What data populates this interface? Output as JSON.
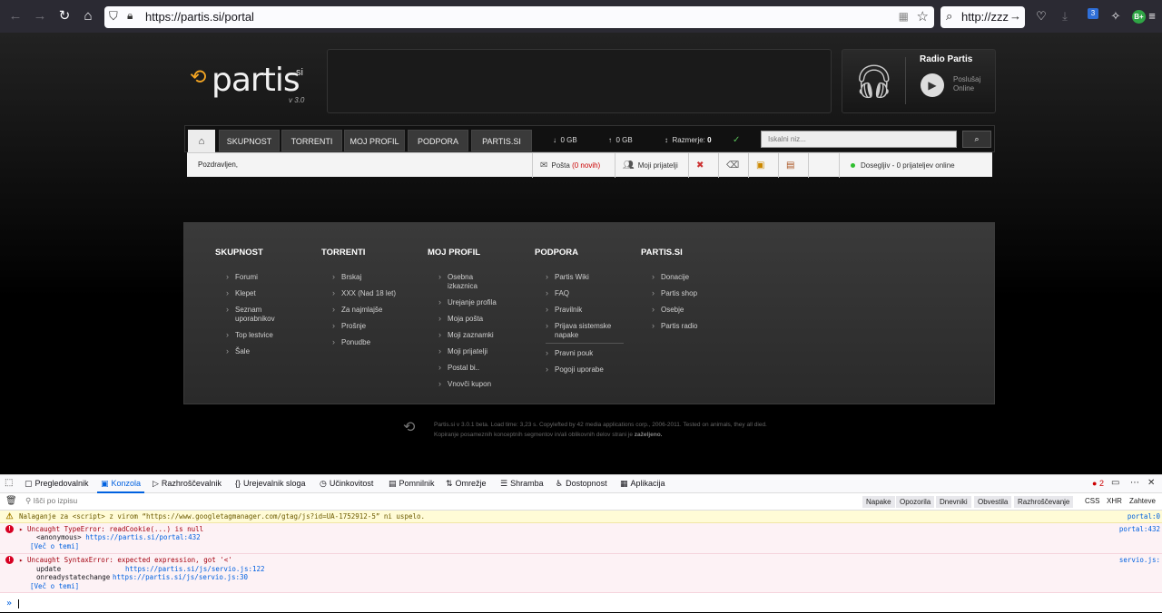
{
  "browser": {
    "url": "https://partis.si/portal",
    "search_text": "http://zzz",
    "ext_badge": "3",
    "profile_badge": "B+"
  },
  "header": {
    "logo_text": "partis",
    "logo_si": ".si",
    "logo_version": "v 3.0",
    "radio_title": "Radio Partis",
    "radio_line1": "Poslušaj",
    "radio_line2": "Online"
  },
  "nav": {
    "tabs": [
      "SKUPNOST",
      "TORRENTI",
      "MOJ PROFIL",
      "PODPORA",
      "PARTIS.SI"
    ],
    "download": "0 GB",
    "upload": "0 GB",
    "ratio_label": "Razmerje:",
    "ratio_value": "0",
    "search_placeholder": "Iskalni niz..."
  },
  "subbar": {
    "greeting": "Pozdravljen,",
    "mail_label": "Pošta",
    "mail_count": "(0 novih)",
    "friends_label": "Moji prijatelji",
    "status": "Dosegljiv - 0 prijateljev online"
  },
  "sitemap": [
    {
      "title": "SKUPNOST",
      "items": [
        "Forumi",
        "Klepet",
        "Seznam uporabnikov",
        "Top lestvice",
        "Šale"
      ]
    },
    {
      "title": "TORRENTI",
      "items": [
        "Brskaj",
        "XXX (Nad 18 let)",
        "Za najmlajše",
        "Prošnje",
        "Ponudbe"
      ]
    },
    {
      "title": "MOJ PROFIL",
      "items": [
        "Osebna izkaznica",
        "Urejanje profila",
        "Moja pošta",
        "Moji zaznamki",
        "Moji prijatelji",
        "Postal bi..",
        "Vnovči kupon"
      ]
    },
    {
      "title": "PODPORA",
      "items": [
        "Partis Wiki",
        "FAQ",
        "Pravilnik",
        "Prijava sistemske napake",
        "Pravni pouk",
        "Pogoji uporabe"
      ]
    },
    {
      "title": "PARTIS.SI",
      "items": [
        "Donacije",
        "Partis shop",
        "Osebje",
        "Partis radio"
      ]
    }
  ],
  "footer": {
    "line1": "Partis.si v 3.0.1 beta. Load time: 3,23 s. Copylefted by 42 media applications corp., 2006-2011. Tested on animals, they all died.",
    "line2": "Kopiranje posameznih konceptnih segmentov in/ali oblikovnih delov strani je",
    "line2_bold": "zaželjeno."
  },
  "devtools": {
    "tabs": [
      "Pregledovalnik",
      "Konzola",
      "Razhroščevalnik",
      "Urejevalnik sloga",
      "Učinkovitost",
      "Pomnilnik",
      "Omrežje",
      "Shramba",
      "Dostopnost",
      "Aplikacija"
    ],
    "error_count": "2",
    "filter_placeholder": "Išči po izpisu",
    "chips": [
      "Napake",
      "Opozorila",
      "Dnevniki",
      "Obvestila",
      "Razhroščevanje"
    ],
    "plain_filters": [
      "CSS",
      "XHR",
      "Zahteve"
    ],
    "warn_msg": "Nalaganje za <script> z virom “https://www.googletagmanager.com/gtag/js?id=UA-1752912-5” ni uspelo.",
    "warn_src": "portal:0",
    "err1_msg": "Uncaught TypeError: readCookie(...) is null",
    "err1_sub_fn": "<anonymous>",
    "err1_sub_link": "https://partis.si/portal:432",
    "err1_more": "[Več o temi]",
    "err1_src": "portal:432",
    "err2_msg": "Uncaught SyntaxError: expected expression, got '<'",
    "err2_fn1": "update",
    "err2_link1": "https://partis.si/js/servio.js:122",
    "err2_fn2": "onreadystatechange",
    "err2_link2": "https://partis.si/js/servio.js:30",
    "err2_more": "[Več o temi]",
    "err2_src": "servio.js:"
  }
}
